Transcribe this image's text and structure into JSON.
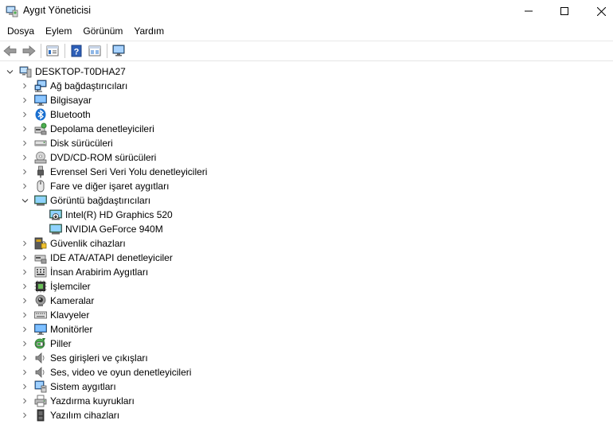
{
  "window": {
    "title": "Aygıt Yöneticisi"
  },
  "menu": [
    {
      "label": "Dosya",
      "name": "menu-dosya"
    },
    {
      "label": "Eylem",
      "name": "menu-eylem"
    },
    {
      "label": "Görünüm",
      "name": "menu-gorunum"
    },
    {
      "label": "Yardım",
      "name": "menu-yardim"
    }
  ],
  "toolbar": [
    {
      "name": "back-button",
      "icon": "back-arrow-icon"
    },
    {
      "name": "forward-button",
      "icon": "forward-arrow-icon"
    },
    {
      "sep": true
    },
    {
      "name": "properties-button",
      "icon": "properties-icon"
    },
    {
      "sep": true
    },
    {
      "name": "help-button",
      "icon": "help-icon"
    },
    {
      "name": "view-button",
      "icon": "view-icon"
    },
    {
      "sep": true
    },
    {
      "name": "scan-hardware-button",
      "icon": "monitor-scan-icon"
    }
  ],
  "tree": {
    "root": {
      "label": "DESKTOP-T0DHA27",
      "icon": "computer-icon",
      "expanded": true
    },
    "categories": [
      {
        "label": "Ağ bağdaştırıcıları",
        "icon": "network-adapter-icon",
        "expanded": false
      },
      {
        "label": "Bilgisayar",
        "icon": "computer-monitor-icon",
        "expanded": false
      },
      {
        "label": "Bluetooth",
        "icon": "bluetooth-icon",
        "expanded": false
      },
      {
        "label": "Depolama denetleyicileri",
        "icon": "storage-controller-icon",
        "expanded": false
      },
      {
        "label": "Disk sürücüleri",
        "icon": "disk-drive-icon",
        "expanded": false
      },
      {
        "label": "DVD/CD-ROM sürücüleri",
        "icon": "dvd-icon",
        "expanded": false
      },
      {
        "label": "Evrensel Seri Veri Yolu denetleyicileri",
        "icon": "usb-icon",
        "expanded": false
      },
      {
        "label": "Fare ve diğer işaret aygıtları",
        "icon": "mouse-icon",
        "expanded": false
      },
      {
        "label": "Görüntü bağdaştırıcıları",
        "icon": "display-adapter-icon",
        "expanded": true,
        "children": [
          {
            "label": "Intel(R) HD Graphics 520",
            "icon": "display-adapter-disabled-icon"
          },
          {
            "label": "NVIDIA GeForce 940M",
            "icon": "display-adapter-icon"
          }
        ]
      },
      {
        "label": "Güvenlik cihazları",
        "icon": "security-device-icon",
        "expanded": false
      },
      {
        "label": "IDE ATA/ATAPI denetleyiciler",
        "icon": "ide-controller-icon",
        "expanded": false
      },
      {
        "label": "İnsan Arabirim Aygıtları",
        "icon": "hid-icon",
        "expanded": false
      },
      {
        "label": "İşlemciler",
        "icon": "processor-icon",
        "expanded": false
      },
      {
        "label": "Kameralar",
        "icon": "camera-icon",
        "expanded": false
      },
      {
        "label": "Klavyeler",
        "icon": "keyboard-icon",
        "expanded": false
      },
      {
        "label": "Monitörler",
        "icon": "monitor-icon",
        "expanded": false
      },
      {
        "label": "Piller",
        "icon": "battery-icon",
        "expanded": false
      },
      {
        "label": "Ses girişleri ve çıkışları",
        "icon": "speaker-icon",
        "expanded": false
      },
      {
        "label": "Ses, video ve oyun denetleyicileri",
        "icon": "speaker-icon",
        "expanded": false
      },
      {
        "label": "Sistem aygıtları",
        "icon": "system-device-icon",
        "expanded": false
      },
      {
        "label": "Yazdırma kuyrukları",
        "icon": "printer-icon",
        "expanded": false
      },
      {
        "label": "Yazılım cihazları",
        "icon": "software-device-icon",
        "expanded": false
      }
    ]
  }
}
